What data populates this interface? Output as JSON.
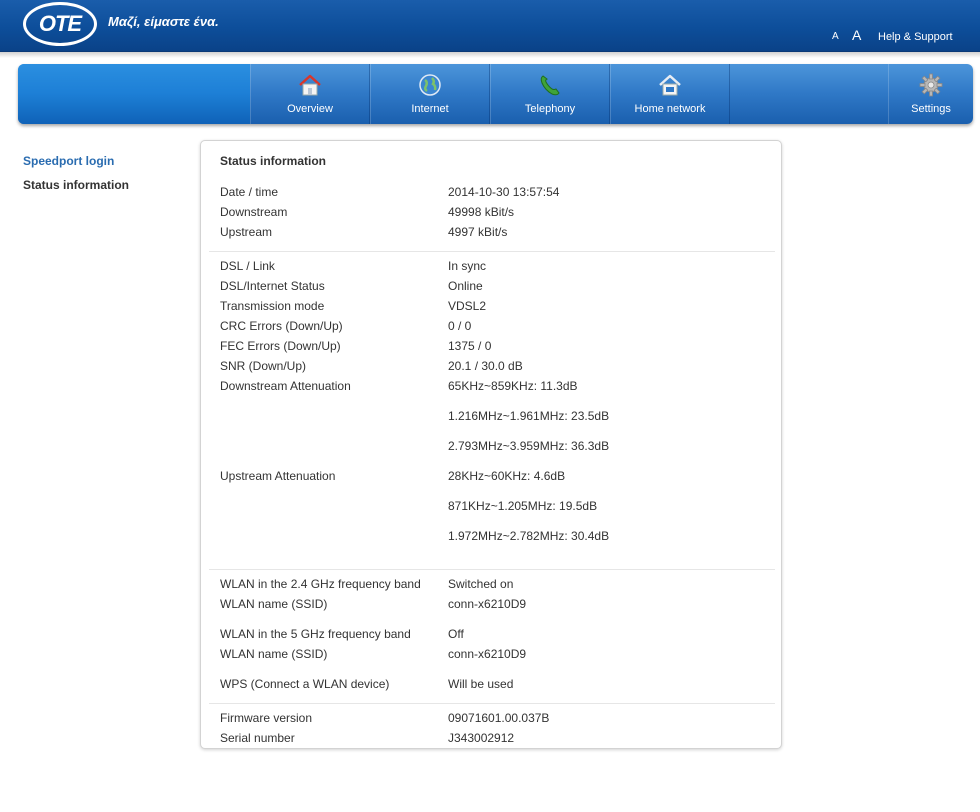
{
  "header": {
    "logo_text": "OTE",
    "slogan": "Μαζί, είμαστε ένα.",
    "font_small": "A",
    "font_large": "A",
    "help_link": "Help & Support"
  },
  "nav": {
    "overview": "Overview",
    "internet": "Internet",
    "telephony": "Telephony",
    "home_network": "Home network",
    "settings": "Settings"
  },
  "sidebar": {
    "items": [
      {
        "label": "Speedport login"
      },
      {
        "label": "Status information"
      }
    ]
  },
  "panel": {
    "title": "Status information",
    "general": {
      "date_label": "Date / time",
      "date_value": "2014-10-30 13:57:54",
      "down_label": "Downstream",
      "down_value": "49998 kBit/s",
      "up_label": "Upstream",
      "up_value": "4997 kBit/s"
    },
    "dsl": {
      "link_label": "DSL / Link",
      "link_value": "In sync",
      "status_label": "DSL/Internet Status",
      "status_value": "Online",
      "mode_label": "Transmission mode",
      "mode_value": "VDSL2",
      "crc_label": "CRC Errors (Down/Up)",
      "crc_value": "0 / 0",
      "fec_label": "FEC Errors (Down/Up)",
      "fec_value": "1375 / 0",
      "snr_label": "SNR (Down/Up)",
      "snr_value": "20.1 / 30.0 dB",
      "down_att_label": "Downstream Attenuation",
      "down_att": [
        "65KHz~859KHz: 11.3dB",
        "1.216MHz~1.961MHz: 23.5dB",
        "2.793MHz~3.959MHz: 36.3dB"
      ],
      "up_att_label": "Upstream Attenuation",
      "up_att": [
        "28KHz~60KHz: 4.6dB",
        "871KHz~1.205MHz: 19.5dB",
        "1.972MHz~2.782MHz: 30.4dB"
      ]
    },
    "wlan": {
      "band24_label": "WLAN in the 2.4 GHz frequency band",
      "band24_value": "Switched on",
      "ssid24_label": "WLAN name (SSID)",
      "ssid24_value": "conn-x6210D9",
      "band5_label": "WLAN in the 5 GHz frequency band",
      "band5_value": "Off",
      "ssid5_label": "WLAN name (SSID)",
      "ssid5_value": "conn-x6210D9",
      "wps_label": "WPS (Connect a WLAN device)",
      "wps_value": "Will be used"
    },
    "device": {
      "fw_label": "Firmware version",
      "fw_value": "09071601.00.037B",
      "serial_label": "Serial number",
      "serial_value": "J343002912"
    }
  },
  "icons": {
    "overview": "house-icon",
    "internet": "globe-icon",
    "telephony": "phone-handset-icon",
    "home_network": "house-network-icon",
    "settings": "gear-icon"
  },
  "colors": {
    "header_blue": "#0d4e9a",
    "nav_blue": "#2f78c6",
    "link_blue": "#2a6cb0"
  }
}
